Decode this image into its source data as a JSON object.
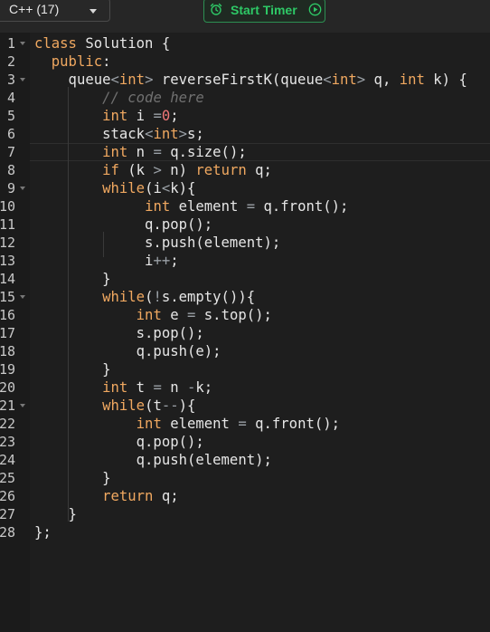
{
  "toolbar": {
    "language": "C++ (17)",
    "timer_label": "Start Timer"
  },
  "editor": {
    "line_numbers": [
      "1",
      "2",
      "3",
      "4",
      "5",
      "6",
      "7",
      "8",
      "9",
      "10",
      "11",
      "12",
      "13",
      "14",
      "15",
      "16",
      "17",
      "18",
      "19",
      "20",
      "21",
      "22",
      "23",
      "24",
      "25",
      "26",
      "27",
      "28"
    ],
    "active_line": 7,
    "lines": [
      [
        [
          "kw",
          "class"
        ],
        [
          "tx",
          " Solution {"
        ]
      ],
      [
        [
          "tx",
          "  "
        ],
        [
          "kw",
          "public"
        ],
        [
          "tx",
          ":"
        ]
      ],
      [
        [
          "tx",
          "    queue"
        ],
        [
          "op",
          "<"
        ],
        [
          "ty",
          "int"
        ],
        [
          "op",
          ">"
        ],
        [
          "tx",
          " reverseFirstK(queue"
        ],
        [
          "op",
          "<"
        ],
        [
          "ty",
          "int"
        ],
        [
          "op",
          ">"
        ],
        [
          "tx",
          " q, "
        ],
        [
          "ty",
          "int"
        ],
        [
          "tx",
          " k) {"
        ]
      ],
      [
        [
          "tx",
          "        "
        ],
        [
          "cm",
          "// code here"
        ]
      ],
      [
        [
          "tx",
          "        "
        ],
        [
          "ty",
          "int"
        ],
        [
          "tx",
          " i "
        ],
        [
          "op",
          "="
        ],
        [
          "num",
          "0"
        ],
        [
          "tx",
          ";"
        ]
      ],
      [
        [
          "tx",
          "        stack"
        ],
        [
          "op",
          "<"
        ],
        [
          "ty",
          "int"
        ],
        [
          "op",
          ">"
        ],
        [
          "tx",
          "s;"
        ]
      ],
      [
        [
          "tx",
          "        "
        ],
        [
          "ty",
          "int"
        ],
        [
          "tx",
          " n "
        ],
        [
          "op",
          "="
        ],
        [
          "tx",
          " q.size();"
        ]
      ],
      [
        [
          "tx",
          "        "
        ],
        [
          "kw",
          "if"
        ],
        [
          "tx",
          " (k "
        ],
        [
          "op",
          ">"
        ],
        [
          "tx",
          " n) "
        ],
        [
          "kw",
          "return"
        ],
        [
          "tx",
          " q;"
        ]
      ],
      [
        [
          "tx",
          "        "
        ],
        [
          "kw",
          "while"
        ],
        [
          "tx",
          "(i"
        ],
        [
          "op",
          "<"
        ],
        [
          "tx",
          "k){"
        ]
      ],
      [
        [
          "tx",
          "             "
        ],
        [
          "ty",
          "int"
        ],
        [
          "tx",
          " element "
        ],
        [
          "op",
          "="
        ],
        [
          "tx",
          " q.front();"
        ]
      ],
      [
        [
          "tx",
          "             q.pop();"
        ]
      ],
      [
        [
          "tx",
          "             s.push(element);"
        ]
      ],
      [
        [
          "tx",
          "             i"
        ],
        [
          "op",
          "++"
        ],
        [
          "tx",
          ";"
        ]
      ],
      [
        [
          "tx",
          "        }"
        ]
      ],
      [
        [
          "tx",
          "        "
        ],
        [
          "kw",
          "while"
        ],
        [
          "tx",
          "("
        ],
        [
          "op",
          "!"
        ],
        [
          "tx",
          "s.empty()){"
        ]
      ],
      [
        [
          "tx",
          "            "
        ],
        [
          "ty",
          "int"
        ],
        [
          "tx",
          " e "
        ],
        [
          "op",
          "="
        ],
        [
          "tx",
          " s.top();"
        ]
      ],
      [
        [
          "tx",
          "            s.pop();"
        ]
      ],
      [
        [
          "tx",
          "            q.push(e);"
        ]
      ],
      [
        [
          "tx",
          "        }"
        ]
      ],
      [
        [
          "tx",
          "        "
        ],
        [
          "ty",
          "int"
        ],
        [
          "tx",
          " t "
        ],
        [
          "op",
          "="
        ],
        [
          "tx",
          " n "
        ],
        [
          "op",
          "-"
        ],
        [
          "tx",
          "k;"
        ]
      ],
      [
        [
          "tx",
          "        "
        ],
        [
          "kw",
          "while"
        ],
        [
          "tx",
          "(t"
        ],
        [
          "op",
          "--"
        ],
        [
          "tx",
          "){"
        ]
      ],
      [
        [
          "tx",
          "            "
        ],
        [
          "ty",
          "int"
        ],
        [
          "tx",
          " element "
        ],
        [
          "op",
          "="
        ],
        [
          "tx",
          " q.front();"
        ]
      ],
      [
        [
          "tx",
          "            q.pop();"
        ]
      ],
      [
        [
          "tx",
          "            q.push(element);"
        ]
      ],
      [
        [
          "tx",
          "        }"
        ]
      ],
      [
        [
          "tx",
          "        "
        ],
        [
          "kw",
          "return"
        ],
        [
          "tx",
          " q;"
        ]
      ],
      [
        [
          "tx",
          "    }"
        ]
      ],
      [
        [
          "tx",
          "};"
        ]
      ]
    ]
  },
  "colors": {
    "keyword": "#f0a860",
    "number": "#f07878",
    "operator": "#9aa0a6",
    "comment": "#707070",
    "text": "#e6e6e6",
    "timer_accent": "#2ec866"
  },
  "icons": {
    "timer": "alarm-clock-icon",
    "timer_end": "play-circle-icon",
    "dropdown": "chevron-down-icon"
  }
}
